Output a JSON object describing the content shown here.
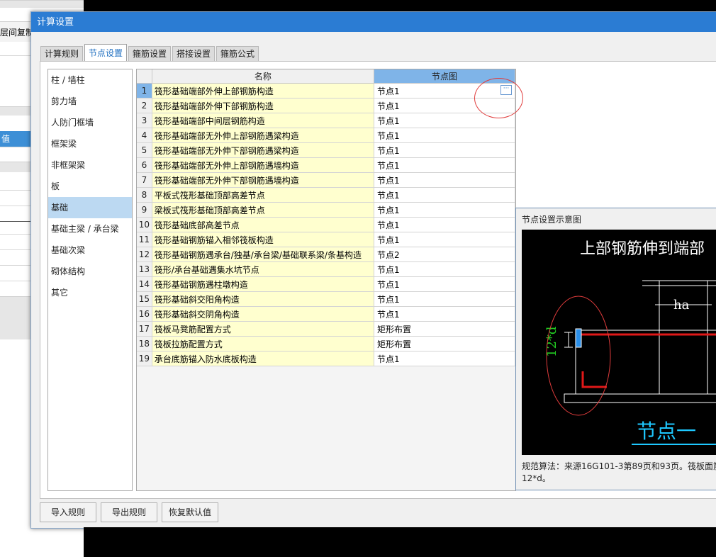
{
  "background": {
    "close_glyph": "×",
    "copy_label": "层间复制",
    "value_label": "值"
  },
  "dialog": {
    "title": "计算设置",
    "tabs": [
      "计算规则",
      "节点设置",
      "箍筋设置",
      "搭接设置",
      "箍筋公式"
    ],
    "active_tab": 1
  },
  "categories": {
    "items": [
      "柱 / 墙柱",
      "剪力墙",
      "人防门框墙",
      "框架梁",
      "非框架梁",
      "板",
      "基础",
      "基础主梁 / 承台梁",
      "基础次梁",
      "砌体结构",
      "其它"
    ],
    "selected": 6
  },
  "grid": {
    "headers": {
      "name": "名称",
      "node": "节点图"
    },
    "ellipsis": "···",
    "rows": [
      {
        "no": "1",
        "name": "筏形基础端部外伸上部钢筋构造",
        "value": "节点1"
      },
      {
        "no": "2",
        "name": "筏形基础端部外伸下部钢筋构造",
        "value": "节点1"
      },
      {
        "no": "3",
        "name": "筏形基础端部中间层钢筋构造",
        "value": "节点1"
      },
      {
        "no": "4",
        "name": "筏形基础端部无外伸上部钢筋遇梁构造",
        "value": "节点1"
      },
      {
        "no": "5",
        "name": "筏形基础端部无外伸下部钢筋遇梁构造",
        "value": "节点1"
      },
      {
        "no": "6",
        "name": "筏形基础端部无外伸上部钢筋遇墙构造",
        "value": "节点1"
      },
      {
        "no": "7",
        "name": "筏形基础端部无外伸下部钢筋遇墙构造",
        "value": "节点1"
      },
      {
        "no": "8",
        "name": "平板式筏形基础顶部高差节点",
        "value": "节点1"
      },
      {
        "no": "9",
        "name": "梁板式筏形基础顶部高差节点",
        "value": "节点1"
      },
      {
        "no": "10",
        "name": "筏形基础底部高差节点",
        "value": "节点1"
      },
      {
        "no": "11",
        "name": "筏形基础钢筋锚入相邻筏板构造",
        "value": "节点1"
      },
      {
        "no": "12",
        "name": "筏形基础钢筋遇承台/独基/承台梁/基础联系梁/条基构造",
        "value": "节点2"
      },
      {
        "no": "13",
        "name": "筏形/承台基础遇集水坑节点",
        "value": "节点1"
      },
      {
        "no": "14",
        "name": "筏形基础钢筋遇柱墩构造",
        "value": "节点1"
      },
      {
        "no": "15",
        "name": "筏形基础斜交阳角构造",
        "value": "节点1"
      },
      {
        "no": "16",
        "name": "筏形基础斜交阴角构造",
        "value": "节点1"
      },
      {
        "no": "17",
        "name": "筏板马凳筋配置方式",
        "value": "矩形布置"
      },
      {
        "no": "18",
        "name": "筏板拉筋配置方式",
        "value": "矩形布置"
      },
      {
        "no": "19",
        "name": "承台底筋锚入防水底板构造",
        "value": "节点1"
      }
    ]
  },
  "buttons": {
    "import": "导入规则",
    "export": "导出规则",
    "restore": "恢复默认值"
  },
  "preview": {
    "title": "节点设置示意图",
    "drawing_title": "上部钢筋伸到端部",
    "dim_ha": "ha",
    "dim_12d": "12*d",
    "node_label": "节点一",
    "description_line1": "规范算法：来源16G101-3第89页和93页。筏板面筋",
    "description_line2": "12*d。",
    "colors": {
      "rebar": "#e01818",
      "dimension": "#22cc22",
      "caption": "#1ec8ff",
      "annotation_circle": "#e03c3c"
    }
  },
  "colors": {
    "titlebar": "#2b7cd3",
    "selected_header": "#7fb4e8",
    "name_cell": "#ffffcf",
    "selected_category": "#bcd9f2"
  }
}
